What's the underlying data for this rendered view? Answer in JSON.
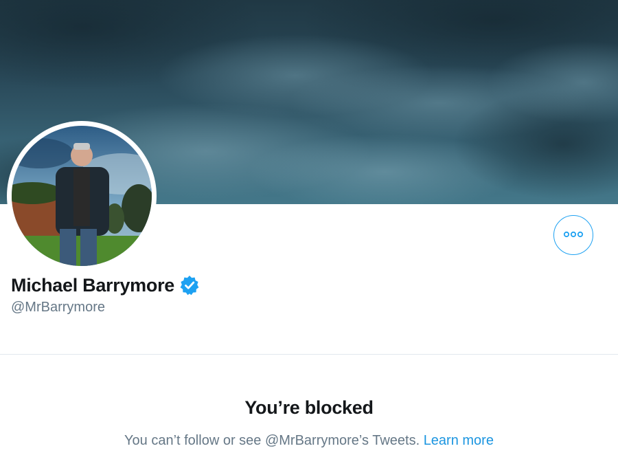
{
  "profile": {
    "display_name": "Michael Barrymore",
    "handle": "@MrBarrymore",
    "verified": true
  },
  "blocked": {
    "title": "You’re blocked",
    "message": "You can’t follow or see @MrBarrymore’s Tweets. ",
    "learn_more": "Learn more"
  },
  "icons": {
    "more": "more-options-icon",
    "verified": "verified-badge-icon"
  },
  "colors": {
    "accent": "#1da1f2",
    "link": "#1b95e0",
    "primary_text": "#14171a",
    "secondary_text": "#657786",
    "divider": "#e1e8ed"
  }
}
